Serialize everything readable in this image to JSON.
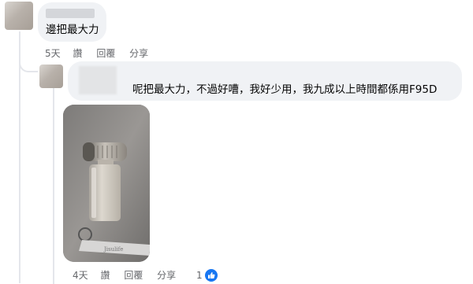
{
  "top_comment": {
    "text": "邊把最大力",
    "time": "5天",
    "actions": [
      "讚",
      "回覆",
      "分享"
    ]
  },
  "reply": {
    "text": "呢把最大力，不過好嘈，我好少用，我九成以上時間都係用F95D",
    "time": "4天",
    "actions": [
      "讚",
      "回覆",
      "分享"
    ],
    "like_count": "1"
  },
  "photo": {
    "label": "device photo",
    "strap_text": "Jisulife"
  },
  "colors": {
    "bubble": "#f0f2f5",
    "meta_text": "#65676b",
    "like_blue": "#1877f2"
  }
}
